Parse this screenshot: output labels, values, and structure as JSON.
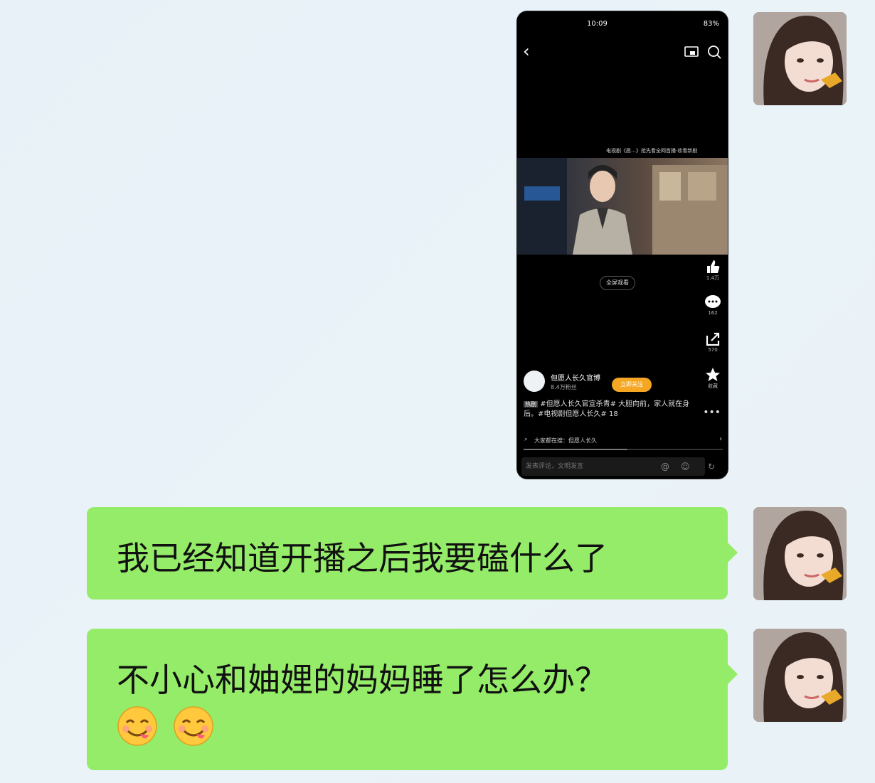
{
  "screenshot": {
    "status_time": "10:09",
    "status_right": "83%",
    "video_caption": "电视剧《愿…》抢先看全网首播·收看新剧",
    "fullscreen_label": "全屏观看",
    "like_count": "1.4万",
    "comment_count": "162",
    "share_count": "570",
    "favorite_label": "收藏",
    "account_name": "但愿人长久官博",
    "account_fans": "8.4万粉丝",
    "follow_button": "立即关注",
    "desc_tag": "热剧",
    "description": "#但愿人长久官宣杀青# 大胆向前，家人就在身后。#电视剧但愿人长久#",
    "desc_count": "18",
    "search_text": "大家都在搜：但愿人长久",
    "comment_placeholder": "发表评论，文明发言"
  },
  "messages": [
    {
      "text": "我已经知道开播之后我要磕什么了"
    },
    {
      "text": "不小心和妯娌的妈妈睡了怎么办？",
      "emojis": [
        "yum-emoji",
        "yum-emoji"
      ]
    }
  ],
  "colors": {
    "bubble": "#95ec69",
    "background": "#e8f2f8",
    "follow": "#f5a623"
  }
}
